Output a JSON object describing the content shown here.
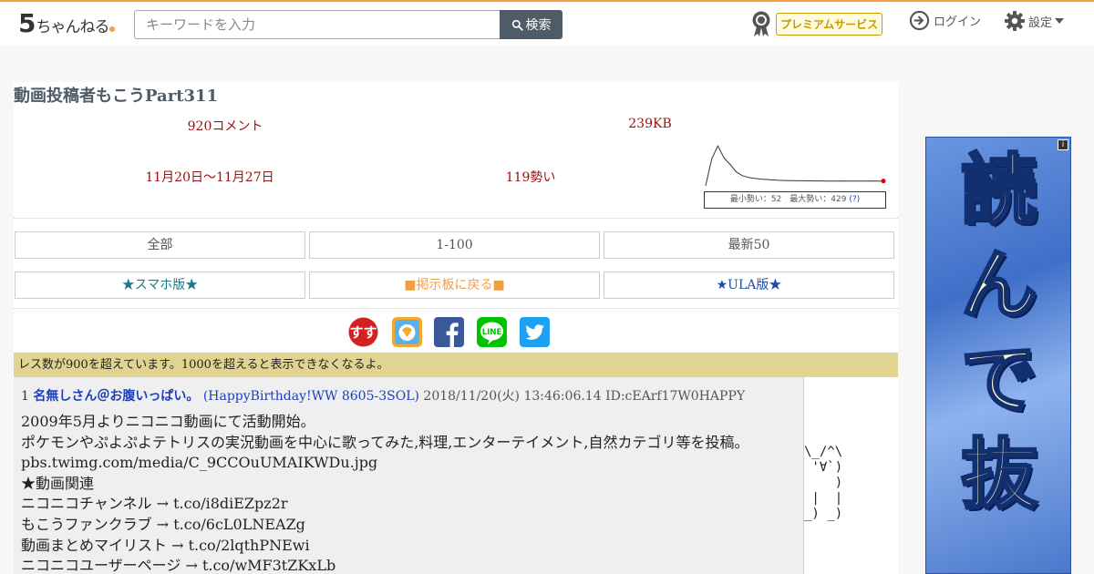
{
  "header": {
    "logo_number": "5",
    "logo_text": "ちゃんねる",
    "search_placeholder": "キーワードを入力",
    "search_button": "検索",
    "premium_label": "プレミアムサービス",
    "login_label": "ログイン",
    "settings_label": "設定",
    "accent_color": "#f0a040"
  },
  "thread": {
    "title": "動画投稿者もこうPart311",
    "comment_count": "920コメント",
    "size": "239KB",
    "date_range": "11月20日〜11月27日",
    "momentum": "119勢い",
    "graph_legend": "最小勢い：52　最大勢い：429",
    "graph_help": "(?)"
  },
  "chart_data": {
    "type": "line",
    "title": "",
    "xlabel": "",
    "ylabel": "",
    "series": [
      {
        "values": [
          0,
          290,
          429,
          300,
          230,
          150,
          110,
          90,
          80,
          72,
          68,
          64,
          60,
          58,
          56,
          55,
          55,
          54,
          53,
          53,
          52,
          52,
          53,
          52,
          52,
          52,
          52,
          53,
          52,
          52
        ]
      }
    ],
    "ylim": [
      0,
      450
    ],
    "grid": false,
    "line_color": "#333333",
    "end_marker_color": "#e00000"
  },
  "nav": {
    "all": "全部",
    "range": "1-100",
    "latest": "最新50",
    "smartphone": "★スマホ版★",
    "back_to_board": "■掲示板に戻る■",
    "ula": "★ULA版★"
  },
  "share": {
    "icons": [
      "sumaho-icon",
      "bookmark-icon",
      "facebook-icon",
      "line-icon",
      "twitter-icon"
    ],
    "line_label": "LINE",
    "sumaho_label": "すす"
  },
  "warning": "レス数が900を超えています。1000を超えると表示できなくなるよ。",
  "post": {
    "number": "1",
    "name": "名無しさん＠お腹いっぱい。",
    "trip": "(HappyBirthday!WW 8605-3SOL)",
    "datetime": "2018/11/20(火) 13:46:06.14",
    "id": "ID:cEArf17W0HAPPY",
    "lines": [
      "2009年5月よりニコニコ動画にて活動開始。",
      "ポケモンやぷよぷよテトリスの実況動画を中心に歌ってみた,料理,エンターテイメント,自然カテゴリ等を投稿。",
      "pbs.twimg.com/media/C_9CCOuUMAIKWDu.jpg",
      "★動画関連",
      "ニコニコチャンネル → t.co/i8diEZpz2r",
      "もこうファンクラブ → t.co/6cL0LNEAZg",
      "動画まとめマイリスト → t.co/2lqthPNEwi",
      "ニコニコユーザーページ → t.co/wMF3tZKxLb"
    ],
    "ascii_art": "\\_/^\\\n '∀`)\n    )\n |  |\n_) _)"
  },
  "ad": {
    "text": "読んで抜",
    "info_label": "i"
  }
}
